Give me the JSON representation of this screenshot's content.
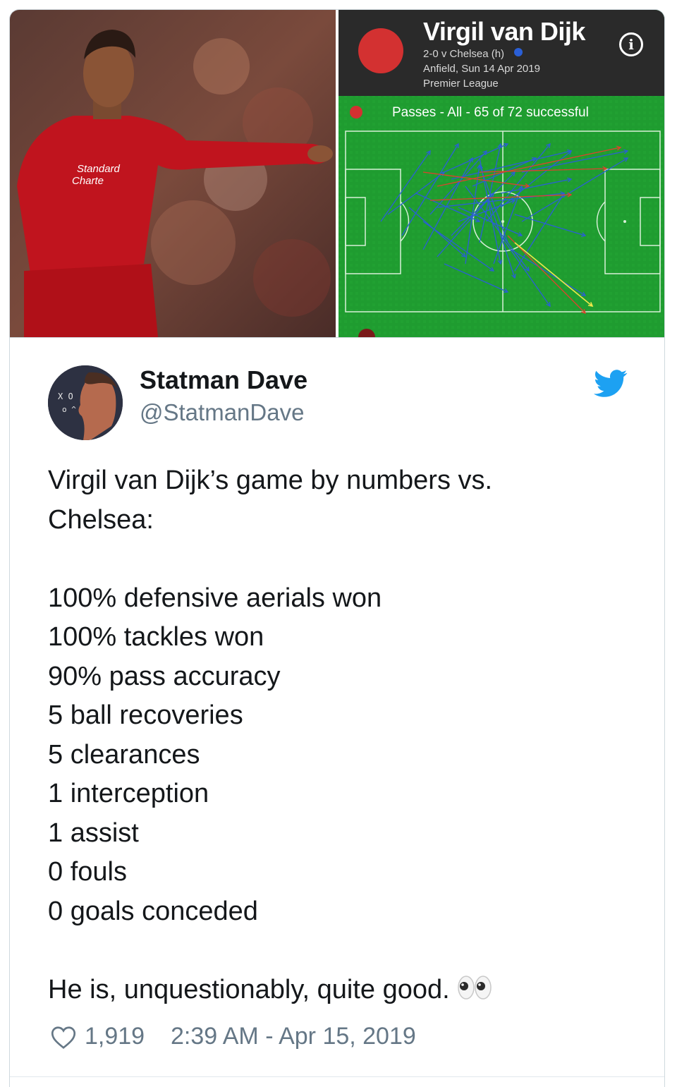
{
  "stat_panel": {
    "player_name": "Virgil van Dijk",
    "match": "2-0 v Chelsea (h)",
    "venue_date": "Anfield, Sun 14 Apr 2019",
    "competition": "Premier League",
    "passes_summary": "Passes - All - 65 of 72 successful",
    "colors": {
      "home": "#d33131",
      "away": "#2a5fd6",
      "pitch": "#1d9a2e"
    }
  },
  "tweet": {
    "author_name": "Statman Dave",
    "author_handle": "@StatmanDave",
    "intro_line_1": "Virgil van Dijk’s game by numbers vs.",
    "intro_line_2": "Chelsea:",
    "stats": [
      "100% defensive aerials won",
      "100% tackles won",
      "90% pass accuracy",
      "5 ball recoveries",
      "5 clearances",
      "1 interception",
      "1 assist",
      "0 fouls",
      "0 goals conceded"
    ],
    "closing": "He is, unquestionably, quite good.",
    "likes": "1,919",
    "timestamp": "2:39 AM - Apr 15, 2019"
  },
  "icons": {
    "twitter": "twitter-bird-icon",
    "like": "heart-icon",
    "info": "info-icon",
    "emoji": "eyes-emoji"
  }
}
